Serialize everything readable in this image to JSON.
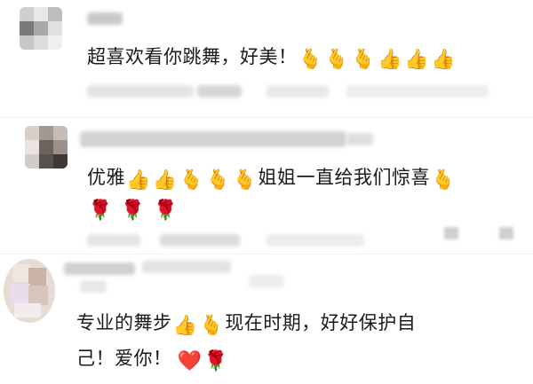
{
  "comments": [
    {
      "text_parts": [
        "超喜欢看你跳舞，好美！"
      ],
      "emojis": [
        "🫰",
        "🫰",
        "🫰",
        "👍",
        "👍",
        "👍"
      ]
    },
    {
      "text_parts": [
        "优雅",
        "姐姐一直给我们惊喜"
      ],
      "emojis_a": [
        "👍",
        "👍",
        "🫰",
        "🫰",
        "🫰"
      ],
      "emojis_b": [
        "🫰"
      ],
      "emojis_c": [
        "🌹",
        "🌹",
        "🌹"
      ]
    },
    {
      "text_parts": [
        "专业的舞步",
        "现在时期，好好保护自",
        "己！爱你！"
      ],
      "emojis_a": [
        "👍",
        "🫰"
      ],
      "emojis_b": [
        "❤️",
        "🌹"
      ]
    }
  ]
}
